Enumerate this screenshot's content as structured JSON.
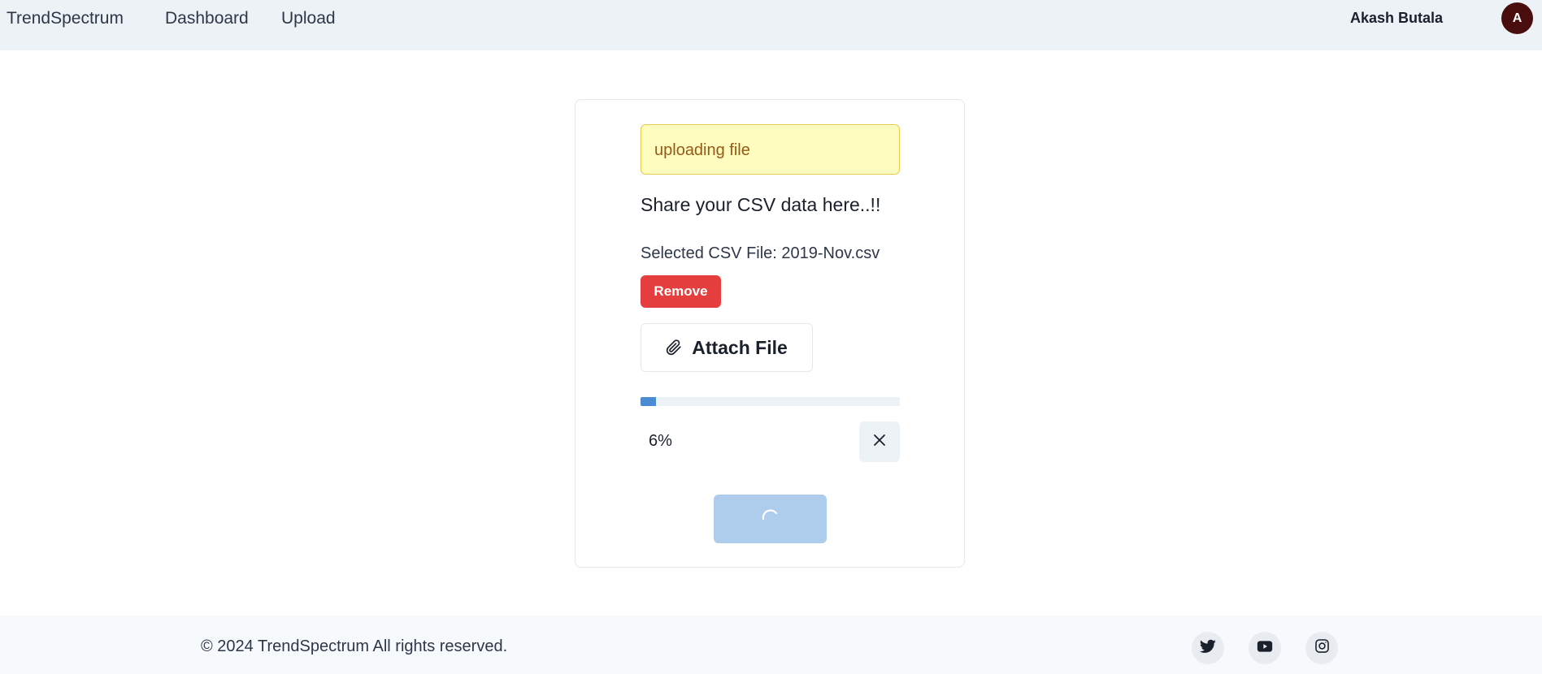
{
  "header": {
    "brand": "TrendSpectrum",
    "nav": {
      "dashboard": "Dashboard",
      "upload": "Upload"
    },
    "user_name": "Akash Butala",
    "avatar_initial": "A"
  },
  "upload_card": {
    "alert_text": "uploading file",
    "heading": "Share your CSV data here..!!",
    "selected_file_text": "Selected CSV File: 2019-Nov.csv",
    "remove_label": "Remove",
    "attach_label": "Attach File",
    "progress_percent": 6,
    "progress_text": "6%"
  },
  "footer": {
    "copyright": "© 2024 TrendSpectrum All rights reserved.",
    "social_icons": [
      "twitter-icon",
      "youtube-icon",
      "instagram-icon"
    ]
  },
  "colors": {
    "alert_bg": "#fefcbf",
    "remove_bg": "#e53e3e",
    "progress_fill": "#4a8bd3",
    "submit_loading_bg": "#aecdec",
    "avatar_bg": "#4a0d0d"
  }
}
